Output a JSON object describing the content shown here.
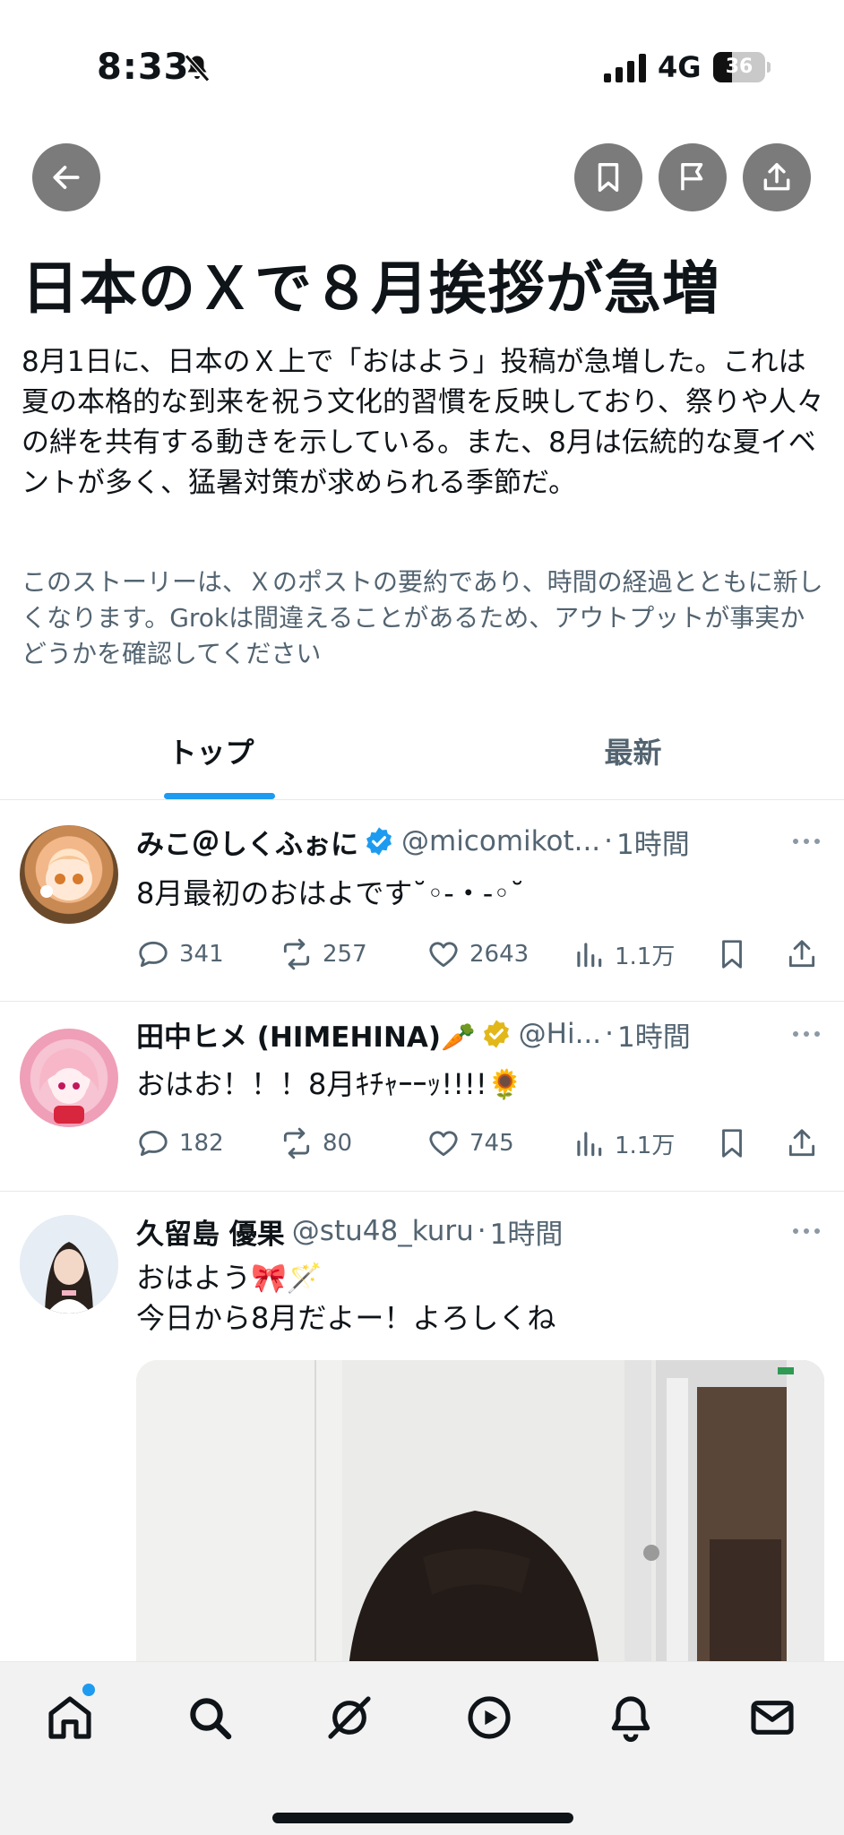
{
  "status_bar": {
    "time": "8:33",
    "network": "4G",
    "battery_level": 36,
    "battery_label": "36",
    "icons": [
      "bell-slash-icon",
      "signal-bars-icon",
      "battery-icon"
    ]
  },
  "toolbar": {
    "icons": [
      "arrow-left-icon",
      "bookmark-icon",
      "flag-icon",
      "share-icon"
    ]
  },
  "story": {
    "title": "日本のＸで８月挨拶が急増",
    "summary": "8月1日に、日本のＸ上で「おはよう」投稿が急増した。これは夏の本格的な到来を祝う文化的習慣を反映しており、祭りや人々の絆を共有する動きを示している。また、8月は伝統的な夏イベントが多く、猛暑対策が求められる季節だ。",
    "disclaimer": "このストーリーは、Ｘのポストの要約であり、時間の経過とともに新しくなります。Grokは間違えることがあるため、アウトプットが事実かどうかを確認してください"
  },
  "tabs": [
    {
      "label": "トップ",
      "active": true
    },
    {
      "label": "最新",
      "active": false
    }
  ],
  "colors": {
    "accent": "#1d9bf0",
    "verified_blue": "#1d9bf0",
    "verified_gold": "#e2b719",
    "secondary_text": "#536471",
    "round_button": "#7b7b7b"
  },
  "posts": [
    {
      "display_name": "みこ＠しくふぉに",
      "verified": "blue",
      "handle": "@micomikot...",
      "time": "1時間",
      "text": "8月最初のおはよです˘◦-・-◦˘",
      "replies": "341",
      "reposts": "257",
      "likes": "2643",
      "views": "1.1万"
    },
    {
      "display_name": "田中ヒメ (HIMEHINA)🥕",
      "verified": "gold",
      "handle": "@Hi...",
      "time": "1時間",
      "text": "おはお！！！8月ｷﾁｬｰｰｯ!!!!🌻",
      "replies": "182",
      "reposts": "80",
      "likes": "745",
      "views": "1.1万"
    },
    {
      "display_name": "久留島 優果",
      "verified": "none",
      "handle": "@stu48_kuru",
      "time": "1時間",
      "text_line1": "おはよう🎀🪄",
      "text_line2": "今日から8月だよー！よろしくね"
    }
  ],
  "bottom_nav": [
    {
      "name": "home-icon",
      "has_badge": true
    },
    {
      "name": "search-icon"
    },
    {
      "name": "grok-icon"
    },
    {
      "name": "play-icon"
    },
    {
      "name": "bell-icon"
    },
    {
      "name": "mail-icon"
    }
  ]
}
